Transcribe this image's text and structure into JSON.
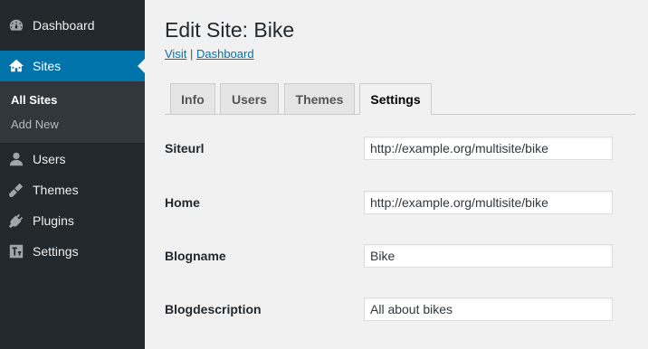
{
  "sidebar": {
    "items": [
      {
        "label": "Dashboard",
        "icon": "dashboard-icon"
      },
      {
        "label": "Sites",
        "icon": "sites-icon"
      },
      {
        "label": "Users",
        "icon": "users-icon"
      },
      {
        "label": "Themes",
        "icon": "themes-icon"
      },
      {
        "label": "Plugins",
        "icon": "plugins-icon"
      },
      {
        "label": "Settings",
        "icon": "settings-icon"
      }
    ],
    "submenu": [
      "All Sites",
      "Add New"
    ]
  },
  "page": {
    "title": "Edit Site: Bike",
    "visit_link": "Visit",
    "separator": "|",
    "dashboard_link": "Dashboard"
  },
  "tabs": [
    "Info",
    "Users",
    "Themes",
    "Settings"
  ],
  "settings": [
    {
      "label": "Siteurl",
      "value": "http://example.org/multisite/bike"
    },
    {
      "label": "Home",
      "value": "http://example.org/multisite/bike"
    },
    {
      "label": "Blogname",
      "value": "Bike"
    },
    {
      "label": "Blogdescription",
      "value": "All about bikes"
    }
  ],
  "colors": {
    "sidebar_bg": "#23282d",
    "submenu_bg": "#32373c",
    "accent": "#0073aa",
    "page_bg": "#f1f1f1"
  }
}
